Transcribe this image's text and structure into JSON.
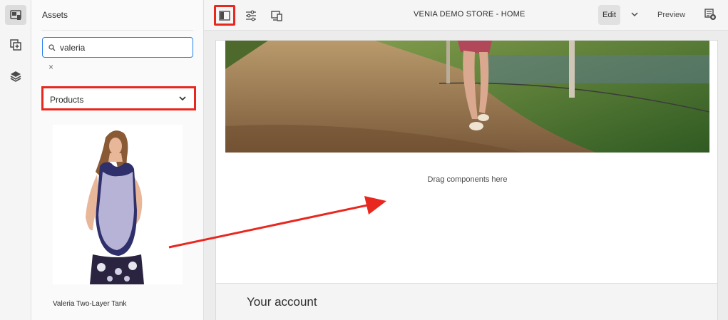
{
  "rail": {
    "items": [
      {
        "icon": "asset-finder-icon",
        "active": true
      },
      {
        "icon": "components-icon",
        "active": false
      },
      {
        "icon": "layers-icon",
        "active": false
      }
    ]
  },
  "assets_panel": {
    "title": "Assets",
    "search": {
      "value": "valeria",
      "placeholder": ""
    },
    "clear_label": "×",
    "filter": {
      "selected": "Products"
    },
    "results": [
      {
        "label": "Valeria Two-Layer Tank"
      }
    ]
  },
  "toolbar": {
    "page_title": "VENIA DEMO STORE - HOME",
    "edit_label": "Edit",
    "preview_label": "Preview"
  },
  "page": {
    "drop_placeholder": "Drag components here",
    "account_heading": "Your account"
  },
  "colors": {
    "highlight": "#e8271f",
    "focus": "#2680eb"
  }
}
